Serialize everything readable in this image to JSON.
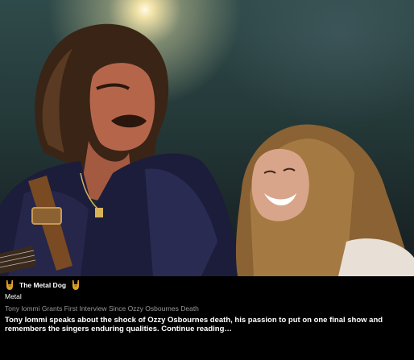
{
  "photo": {
    "alt_subject": "concert-photo"
  },
  "source": {
    "name": "The Metal Dog",
    "icon_left": "rock-horns-icon",
    "icon_right": "rock-horns-icon",
    "icon_color": "#e0a12b"
  },
  "category": "Metal",
  "headline": "Tony Iommi Grants First Interview Since Ozzy Osbournes Death",
  "summary": {
    "text": "Tony Iommi speaks about the shock of Ozzy Osbournes death, his passion to put on one final show and remembers the singers enduring qualities.",
    "more_label": "Continue reading…"
  }
}
